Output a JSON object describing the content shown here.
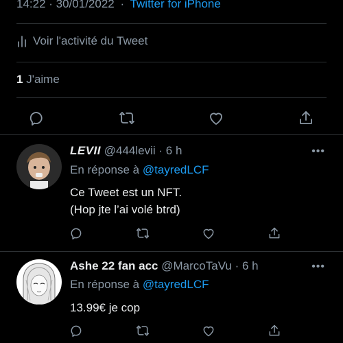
{
  "tweet": {
    "timestamp": "14:22 · 30/01/2022",
    "client_sep": "·",
    "client": "Twitter for iPhone",
    "activity_label": "Voir l'activité du Tweet",
    "likes_count": "1",
    "likes_label": "J'aime"
  },
  "replies": [
    {
      "display_name": "LEVII",
      "handle": "@444levii",
      "time": "6 h",
      "in_reply_prefix": "En réponse à",
      "in_reply_handle": "@tayredLCF",
      "text_line1": "Ce Tweet est un NFT.",
      "text_line2": "(Hop jte l’ai volé btrd)",
      "more": "•••"
    },
    {
      "display_name": "Ashe 22 fan acc",
      "handle": "@MarcoTaVu",
      "time": "6 h",
      "in_reply_prefix": "En réponse à",
      "in_reply_handle": "@tayredLCF",
      "text_line1": "13.99€ je cop",
      "more": "•••"
    }
  ],
  "colors": {
    "background": "#000000",
    "text": "#e7e9ea",
    "muted": "#8b98a5",
    "accent": "#1d9bf0",
    "divider": "#2f3336"
  },
  "icons": [
    "activity-icon",
    "reply-icon",
    "retweet-icon",
    "like-icon",
    "share-icon",
    "more-icon"
  ]
}
